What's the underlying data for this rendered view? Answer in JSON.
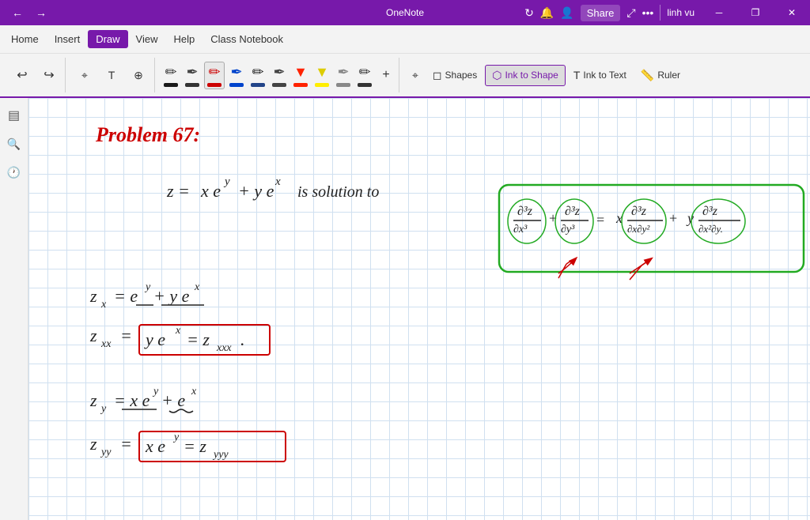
{
  "titlebar": {
    "back_icon": "←",
    "forward_icon": "→",
    "title": "OneNote",
    "user": "linh vu",
    "minimize_icon": "─",
    "restore_icon": "❐",
    "close_icon": "✕"
  },
  "menubar": {
    "items": [
      "Home",
      "Insert",
      "Draw",
      "View",
      "Help",
      "Class Notebook"
    ],
    "active": "Draw"
  },
  "toolbar": {
    "undo_label": "↩",
    "redo_label": "↪",
    "pens": [
      {
        "color": "#000000",
        "label": ""
      },
      {
        "color": "#333333",
        "label": ""
      },
      {
        "color": "#cc0000",
        "label": ""
      },
      {
        "color": "#000000",
        "label": ""
      },
      {
        "color": "#0000cc",
        "label": ""
      },
      {
        "color": "#222222",
        "label": ""
      },
      {
        "color": "#ff0000",
        "label": ""
      },
      {
        "color": "#ffff00",
        "label": ""
      },
      {
        "color": "#888888",
        "label": ""
      },
      {
        "color": "#444444",
        "label": ""
      }
    ],
    "add_label": "+",
    "shapes_label": "Shapes",
    "ink_to_shape_label": "Ink to Shape",
    "ink_to_text_label": "Ink to Text",
    "ruler_label": "Ruler"
  },
  "sidebar": {
    "notebook_icon": "📓",
    "search_icon": "🔍",
    "clock_icon": "🕐"
  },
  "content": {
    "title": "Problem 67:"
  }
}
